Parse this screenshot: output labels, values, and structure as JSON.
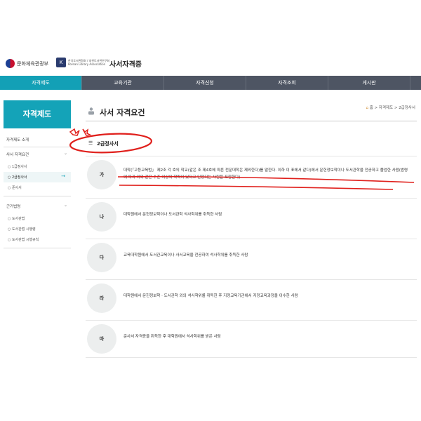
{
  "header": {
    "logo_ministry": "문화체육관광부",
    "logo_kla_ko": "한국도서관협회 / 대한도서관연구회",
    "logo_kla_en": "Korean Library Association",
    "site_title": "사서자격증"
  },
  "nav": [
    "자격제도",
    "교육기관",
    "자격신청",
    "자격조회",
    "게시판"
  ],
  "sidebar": {
    "heading": "자격제도",
    "items": [
      {
        "label": "자격제도 소개"
      },
      {
        "label": "사서 자격요건"
      }
    ],
    "subitems": [
      "1급정사서",
      "2급정사서",
      "준사서"
    ],
    "law_heading": "근거법령",
    "law_items": [
      "도서관법",
      "도서관법 시행령",
      "도서관법 시행규칙"
    ]
  },
  "page": {
    "title": "사서 자격요건",
    "breadcrumb": [
      "홈",
      "자격제도",
      "2급정사서"
    ],
    "section_title": "2급정사서"
  },
  "requirements": [
    {
      "label": "가",
      "text": "대학(「고등교육법」 제2조 각 호의 학교(같은 조 제4호에 따른 전문대학은 제외한다)를 말한다. 이하 이 표에서 같다)에서 문헌정보학이나 도서관학을 전공하고 졸업한 사람(법령에 따라 이와 같은 수준 이상의 학력이 있다고 인정되는 사람을 포함한다)"
    },
    {
      "label": "나",
      "text": "대학원에서 문헌정보학이나 도서관학 석사학위를 취득한 사람"
    },
    {
      "label": "다",
      "text": "교육대학원에서 도서관교육이나 사서교육을 전공하여 석사학위를 취득한 사람"
    },
    {
      "label": "라",
      "text": "대학원에서 문헌정보학 · 도서관학 외의 석사학위를 취득한 후 지정교육기관에서 지정교육과정을 이수한 사람"
    },
    {
      "label": "마",
      "text": "준사서 자격증을 취득한 후 대학원에서 석사학위를 받은 사람"
    }
  ],
  "colors": {
    "accent": "#14a3b8",
    "nav_bg": "#4e5563",
    "annotation": "#e0201c"
  }
}
